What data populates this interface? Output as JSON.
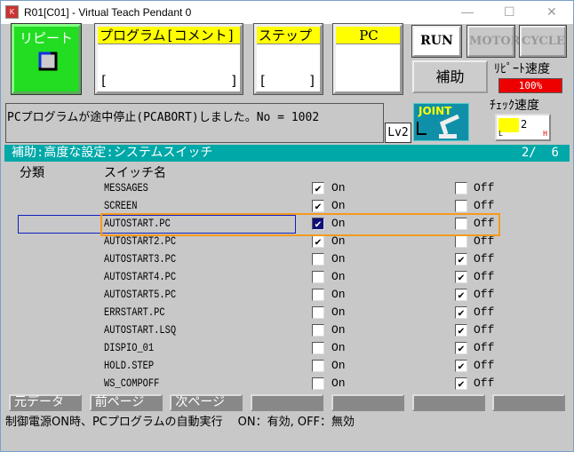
{
  "window": {
    "title": "R01[C01] - Virtual Teach Pendant 0",
    "minimize": "—",
    "maximize": "☐",
    "close": "✕"
  },
  "top": {
    "mode": {
      "label": "リピート",
      "icon": "repeat-cycle-icon",
      "color": "#22dd22"
    },
    "program": {
      "header": "プログラム[コメント]",
      "open": "[",
      "close": "]"
    },
    "step": {
      "header": "ステップ",
      "open": "[",
      "close": "]"
    },
    "pc": {
      "header": "PC"
    },
    "run": "RUN",
    "motor": "MOTOR",
    "cycle": "CYCLE",
    "aux": "補助",
    "repeat_speed": {
      "label": "ﾘﾋﾟｰﾄ速度",
      "value": "100%",
      "color": "#ee0000"
    },
    "check_speed": {
      "label": "ﾁｪｯｸ速度",
      "level": "2",
      "low": "L",
      "high": "H"
    },
    "message": "PCプログラムが途中停止(PCABORT)しました。No = 1002",
    "level": "Lv2",
    "joint": {
      "label": "JOINT",
      "icon": "robot-arm-icon"
    }
  },
  "screen": {
    "title": "補助:高度な設定:システムスイッチ",
    "page": "2/  6",
    "header_color": "#00a8a8"
  },
  "columns": {
    "category": "分類",
    "switch": "スイッチ名"
  },
  "on_label": "On",
  "off_label": "Off",
  "switches": [
    {
      "name": "MESSAGES",
      "on": true
    },
    {
      "name": "SCREEN",
      "on": true
    },
    {
      "name": "AUTOSTART.PC",
      "on": true,
      "selected": true
    },
    {
      "name": "AUTOSTART2.PC",
      "on": true
    },
    {
      "name": "AUTOSTART3.PC",
      "on": false
    },
    {
      "name": "AUTOSTART4.PC",
      "on": false
    },
    {
      "name": "AUTOSTART5.PC",
      "on": false
    },
    {
      "name": "ERRSTART.PC",
      "on": false
    },
    {
      "name": "AUTOSTART.LSQ",
      "on": false
    },
    {
      "name": "DISPIO_01",
      "on": false
    },
    {
      "name": "HOLD.STEP",
      "on": false
    },
    {
      "name": "WS_COMPOFF",
      "on": false
    }
  ],
  "function_keys": [
    "元データ",
    "前ページ",
    "次ページ",
    "",
    "",
    "",
    ""
  ],
  "help": "制御電源ON時、PCプログラムの自動実行　 ON：有効, OFF：無効"
}
